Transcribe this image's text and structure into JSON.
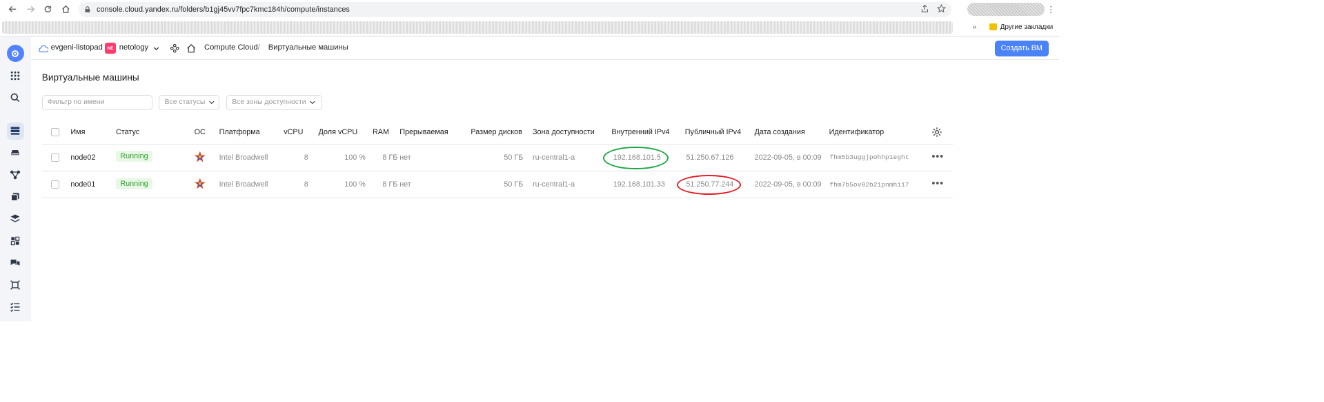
{
  "browser": {
    "url": "console.cloud.yandex.ru/folders/b1gj45vv7fpc7kmc184h/compute/instances",
    "bookmarks_folder": "Другие закладки"
  },
  "header": {
    "cloud_name": "evgeni-listopad",
    "folder_badge": "NE",
    "folder_name": "netology",
    "breadcrumb_service": "Compute Cloud",
    "breadcrumb_sep": "/",
    "breadcrumb_page": "Виртуальные машины",
    "create_button": "Создать ВМ"
  },
  "page": {
    "title": "Виртуальные машины",
    "filter_placeholder": "Фильтр по имени",
    "status_select": "Все статусы",
    "zone_select": "Все зоны доступности"
  },
  "table": {
    "columns": [
      "Имя",
      "Статус",
      "ОС",
      "Платформа",
      "vCPU",
      "Доля vCPU",
      "RAM",
      "Прерываемая",
      "Размер дисков",
      "Зона доступности",
      "Внутренний IPv4",
      "Публичный IPv4",
      "Дата создания",
      "Идентификатор"
    ],
    "rows": [
      {
        "name": "node02",
        "status": "Running",
        "platform": "Intel Broadwell",
        "vcpu": "8",
        "vcpu_share": "100 %",
        "ram": "8 ГБ",
        "preemptible": "нет",
        "disk": "50 ГБ",
        "zone": "ru-central1-a",
        "internal_ip": "192.168.101.5",
        "public_ip": "51.250.67.126",
        "created": "2022-09-05, в 00:09",
        "id": "fhm5b3uggjpohhp1eght"
      },
      {
        "name": "node01",
        "status": "Running",
        "platform": "Intel Broadwell",
        "vcpu": "8",
        "vcpu_share": "100 %",
        "ram": "8 ГБ",
        "preemptible": "нет",
        "disk": "50 ГБ",
        "zone": "ru-central1-a",
        "internal_ip": "192.168.101.33",
        "public_ip": "51.250.77.244",
        "created": "2022-09-05, в 00:09",
        "id": "fhm7b5ov82b21pnmhi17"
      }
    ]
  },
  "colors": {
    "accent": "#4a82f7",
    "running_text": "#2ea12a",
    "running_bg": "#e9f7e7",
    "highlight_green": "#1fa845",
    "highlight_red": "#e21b23"
  }
}
